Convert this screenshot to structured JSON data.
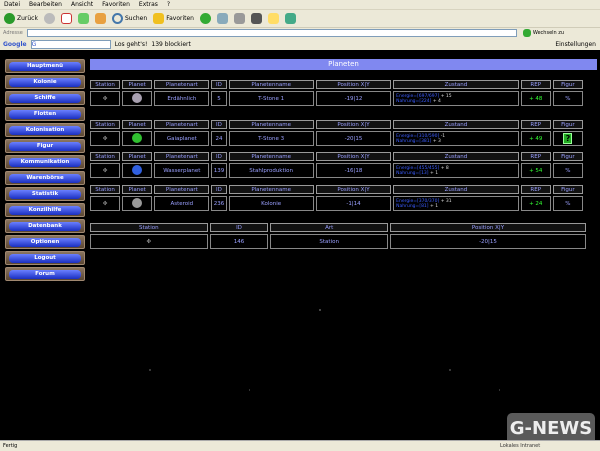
{
  "browser": {
    "menu": [
      "Datei",
      "Bearbeiten",
      "Ansicht",
      "Favoriten",
      "Extras",
      "?"
    ],
    "toolbar": {
      "back": "Zurück",
      "search": "Suchen",
      "favorites": "Favoriten"
    },
    "address_label": "Adresse",
    "address_value": "",
    "go_label": "Wechseln zu",
    "google": {
      "logo": "Google",
      "search_value": "G",
      "go": "Los geht's!",
      "blocked": "139 blockiert",
      "settings": "Einstellungen"
    },
    "status": {
      "left": "Fertig",
      "zone": "Lokales Intranet"
    }
  },
  "nav": [
    "Hauptmenü",
    "Kolonie",
    "Schiffe",
    "Flotten",
    "Kolonisation",
    "Figur",
    "Kommunikation",
    "Warenbörse",
    "Statistik",
    "Konzilhilfe",
    "Datenbank",
    "Optionen",
    "Logout",
    "Forum"
  ],
  "page_title": "Planeten",
  "planet_headers": [
    "Station",
    "Planet",
    "Planetenart",
    "ID",
    "Planetenname",
    "Position X|Y",
    "Zustand",
    "REP",
    "Figur"
  ],
  "planets": [
    {
      "type": "Erdähnlich",
      "id": "5",
      "name": "T-Stone 1",
      "pos": "-19|12",
      "energie": "Energie=[697/697]",
      "energie_delta": "+ 15",
      "nahrung": "Nahrung=[224]",
      "nahrung_delta": "+ 4",
      "rep": "+ 48",
      "figur": "%",
      "planet_color": "#a8a0b0",
      "energie_negative": false
    },
    {
      "type": "Gaiaplanet",
      "id": "24",
      "name": "T-Stone 3",
      "pos": "-20|15",
      "energie": "Energie=[310/590]",
      "energie_delta": "-1",
      "nahrung": "Nahrung=[381]",
      "nahrung_delta": "+ 3",
      "rep": "+ 49",
      "figur": "?",
      "planet_color": "#30c030",
      "energie_negative": true
    },
    {
      "type": "Wasserplanet",
      "id": "139",
      "name": "Stahlproduktion",
      "pos": "-16|18",
      "energie": "Energie=[455/455]",
      "energie_delta": "+ 8",
      "nahrung": "Nahrung=[13]",
      "nahrung_delta": "+ 1",
      "rep": "+ 54",
      "figur": "%",
      "planet_color": "#3060e0",
      "energie_negative": false
    },
    {
      "type": "Asteroid",
      "id": "236",
      "name": "Kolonie",
      "pos": "-1|14",
      "energie": "Energie=[370/370]",
      "energie_delta": "+ 31",
      "nahrung": "Nahrung=[81]",
      "nahrung_delta": "+ 1",
      "rep": "+ 24",
      "figur": "%",
      "planet_color": "#999999",
      "energie_negative": false
    }
  ],
  "station_headers": [
    "Station",
    "ID",
    "Art",
    "Position X|Y"
  ],
  "station": {
    "id": "146",
    "art": "Station",
    "pos": "-20|15"
  },
  "watermark": "G-NEWS"
}
